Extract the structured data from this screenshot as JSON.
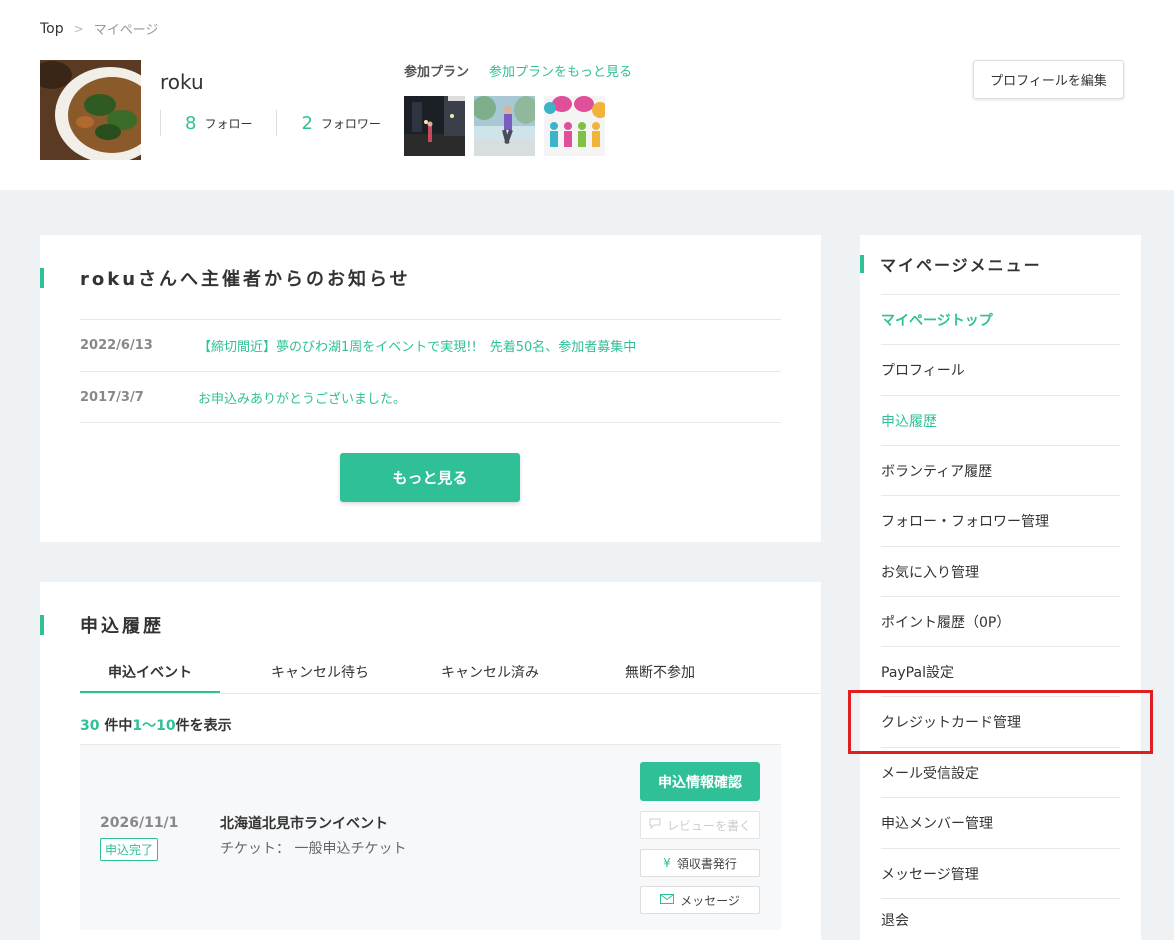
{
  "breadcrumb": {
    "home": "Top",
    "sep": ">",
    "current": "マイページ"
  },
  "profile": {
    "username": "roku",
    "follow_count": "8",
    "follow_label": "フォロー",
    "follower_count": "2",
    "follower_label": "フォロワー",
    "edit_label": "プロフィールを編集"
  },
  "plans": {
    "label": "参加プラン",
    "more_label": "参加プランをもっと見る"
  },
  "notice": {
    "title": "rokuさんへ主催者からのお知らせ",
    "items": [
      {
        "date": "2022/6/13",
        "text": "【締切間近】夢のびわ湖1周をイベントで実現!!　先着50名、参加者募集中"
      },
      {
        "date": "2017/3/7",
        "text": "お申込みありがとうございました。"
      }
    ],
    "more_label": "もっと見る"
  },
  "history": {
    "title": "申込履歴",
    "tabs": [
      "申込イベント",
      "キャンセル待ち",
      "キャンセル済み",
      "無断不参加"
    ],
    "count_total": "30",
    "count_mid": "件中",
    "count_range": "1〜10",
    "count_suffix": "件を表示",
    "entry": {
      "date": "2026/11/1",
      "status": "申込完了",
      "name": "北海道北見市ランイベント",
      "ticket": "チケット：  一般申込チケット",
      "confirm_label": "申込情報確認",
      "review_label": "レビューを書く",
      "receipt_label": "領収書発行",
      "message_label": "メッセージ"
    }
  },
  "menu": {
    "title": "マイページメニュー",
    "items": [
      "マイページトップ",
      "プロフィール",
      "申込履歴",
      "ボランティア履歴",
      "フォロー・フォロワー管理",
      "お気に入り管理",
      "ポイント履歴（0P）",
      "PayPal設定",
      "クレジットカード管理",
      "メール受信設定",
      "申込メンバー管理",
      "メッセージ管理",
      "退会"
    ]
  },
  "colors": {
    "accent": "#2fc098",
    "background": "#eff2f5",
    "highlight": "#e02020"
  }
}
